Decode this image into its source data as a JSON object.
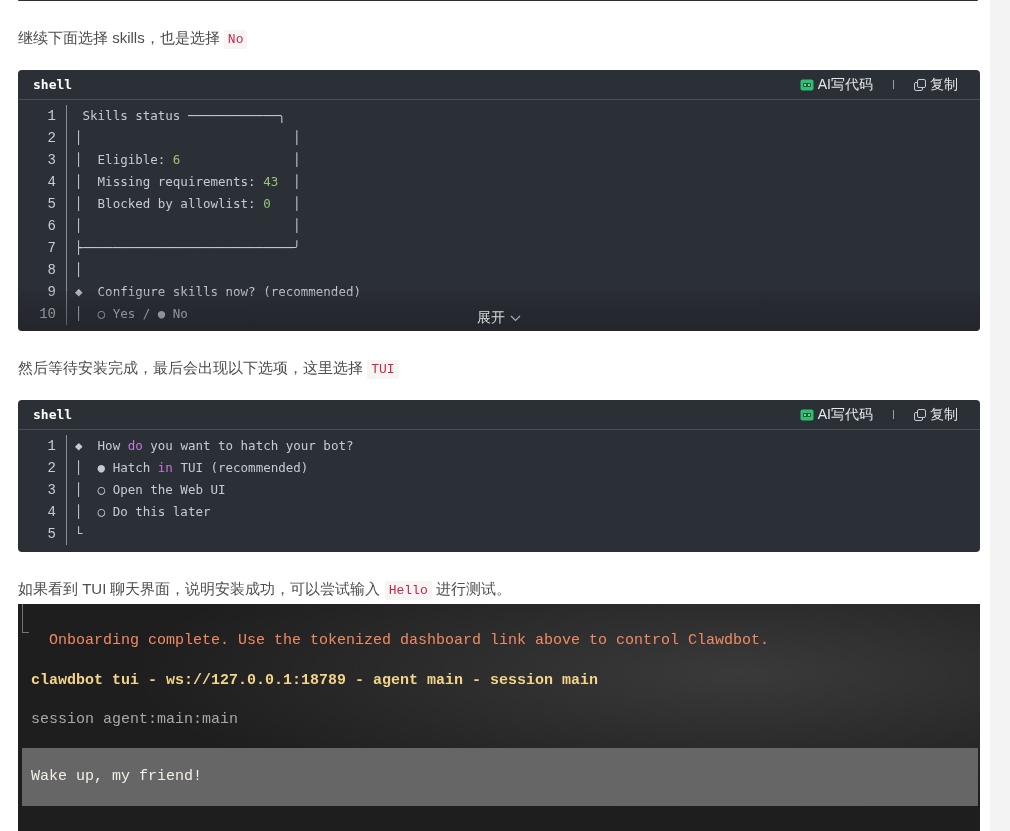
{
  "content": [
    {
      "kind": "paragraph",
      "segments": [
        {
          "text": "继续下面选择 skills，也是选择 ",
          "kind": "text"
        },
        {
          "text": "No",
          "kind": "code"
        }
      ]
    },
    {
      "kind": "code",
      "language": "shell",
      "ai_button": "AI写代码",
      "copy_button": "复制",
      "collapsed": true,
      "expand_button": "展开",
      "lines": [
        {
          "number": "1",
          "tokens": [
            {
              "text": " Skills status ────────────╮",
              "kind": "plain"
            }
          ]
        },
        {
          "number": "2",
          "tokens": [
            {
              "text": "│                            │",
              "kind": "plain"
            }
          ]
        },
        {
          "number": "3",
          "tokens": [
            {
              "text": "│  Eligible: ",
              "kind": "plain"
            },
            {
              "text": "6",
              "kind": "number"
            },
            {
              "text": "               │",
              "kind": "plain"
            }
          ]
        },
        {
          "number": "4",
          "tokens": [
            {
              "text": "│  Missing requirements: ",
              "kind": "plain"
            },
            {
              "text": "43",
              "kind": "number"
            },
            {
              "text": "  │",
              "kind": "plain"
            }
          ]
        },
        {
          "number": "5",
          "tokens": [
            {
              "text": "│  Blocked by allowlist: ",
              "kind": "plain"
            },
            {
              "text": "0",
              "kind": "number"
            },
            {
              "text": "   │",
              "kind": "plain"
            }
          ]
        },
        {
          "number": "6",
          "tokens": [
            {
              "text": "│                            │",
              "kind": "plain"
            }
          ]
        },
        {
          "number": "7",
          "tokens": [
            {
              "text": "├────────────────────────────╯",
              "kind": "plain"
            }
          ]
        },
        {
          "number": "8",
          "tokens": [
            {
              "text": "│",
              "kind": "plain"
            }
          ]
        },
        {
          "number": "9",
          "tokens": [
            {
              "text": "◆  Configure skills now? (recommended)",
              "kind": "plain"
            }
          ]
        },
        {
          "number": "10",
          "tokens": [
            {
              "text": "│  ○ Yes / ● No",
              "kind": "plain"
            }
          ]
        }
      ]
    },
    {
      "kind": "paragraph",
      "segments": [
        {
          "text": "然后等待安装完成，最后会出现以下选项，这里选择 ",
          "kind": "text"
        },
        {
          "text": "TUI",
          "kind": "code"
        }
      ]
    },
    {
      "kind": "code",
      "language": "shell",
      "ai_button": "AI写代码",
      "copy_button": "复制",
      "collapsed": false,
      "lines": [
        {
          "number": "1",
          "tokens": [
            {
              "text": "◆  How ",
              "kind": "plain"
            },
            {
              "text": "do",
              "kind": "keyword"
            },
            {
              "text": " you want to hatch your bot?",
              "kind": "plain"
            }
          ]
        },
        {
          "number": "2",
          "tokens": [
            {
              "text": "│  ● Hatch ",
              "kind": "plain"
            },
            {
              "text": "in",
              "kind": "keyword"
            },
            {
              "text": " TUI (recommended)",
              "kind": "plain"
            }
          ]
        },
        {
          "number": "3",
          "tokens": [
            {
              "text": "│  ○ Open the Web UI",
              "kind": "plain"
            }
          ]
        },
        {
          "number": "4",
          "tokens": [
            {
              "text": "│  ○ Do this later",
              "kind": "plain"
            }
          ]
        },
        {
          "number": "5",
          "tokens": [
            {
              "text": "└",
              "kind": "plain"
            }
          ]
        }
      ]
    },
    {
      "kind": "paragraph",
      "segments": [
        {
          "text": "如果看到 TUI 聊天界面，说明安装成功，可以尝试输入 ",
          "kind": "text"
        },
        {
          "text": "Hello",
          "kind": "code"
        },
        {
          "text": " 进行测试。",
          "kind": "text"
        }
      ]
    },
    {
      "kind": "terminal",
      "lines": [
        {
          "kind": "notice",
          "text": "Onboarding complete. Use the tokenized dashboard link above to control Clawdbot."
        },
        {
          "kind": "title",
          "text": "clawdbot tui - ws://127.0.0.1:18789 - agent main - session main"
        },
        {
          "kind": "meta",
          "text": "session agent:main:main"
        },
        {
          "kind": "message",
          "text": "Wake up, my friend!"
        }
      ]
    }
  ]
}
